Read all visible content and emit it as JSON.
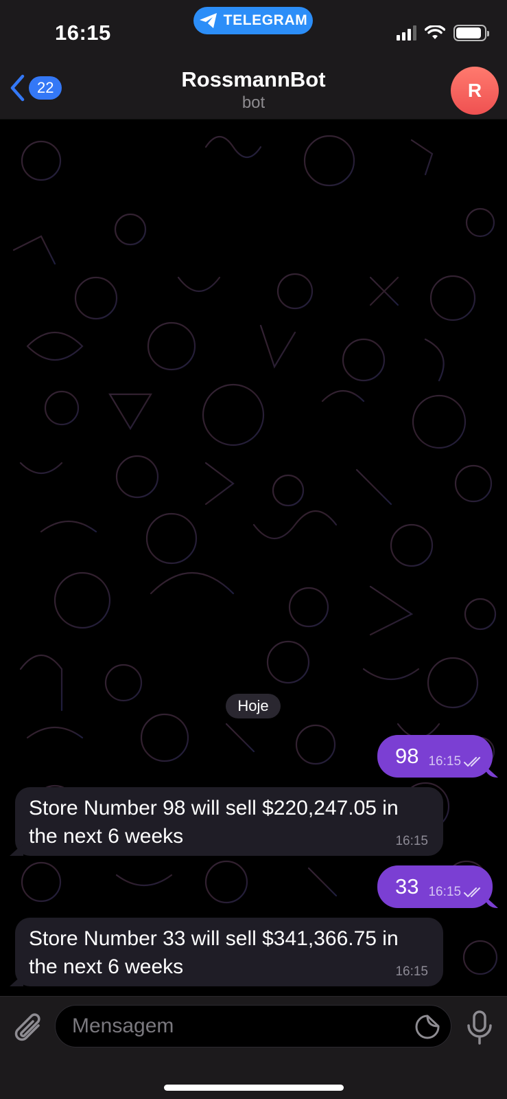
{
  "status_bar": {
    "time": "16:15",
    "app_pill": "TELEGRAM",
    "signal_bars": 3,
    "battery_level": 0.9
  },
  "header": {
    "back_count": "22",
    "title": "RossmannBot",
    "subtitle": "bot",
    "avatar_initial": "R",
    "avatar_color": "#ef5151"
  },
  "chat": {
    "date_chip": "Hoje",
    "messages": [
      {
        "direction": "out",
        "text": "98",
        "time": "16:15",
        "status": "read"
      },
      {
        "direction": "in",
        "text": "Store Number 98 will sell $220,247.05 in the next 6 weeks",
        "time": "16:15"
      },
      {
        "direction": "out",
        "text": "33",
        "time": "16:15",
        "status": "read"
      },
      {
        "direction": "in",
        "text": "Store Number 33 will sell $341,366.75 in the next 6 weeks",
        "time": "16:15"
      }
    ]
  },
  "composer": {
    "placeholder": "Mensagem",
    "value": ""
  },
  "colors": {
    "accent": "#3478f6",
    "outgoing_bubble": "#7b3fd3",
    "incoming_bubble": "#1f1d26",
    "telegram_pill": "#2c8ef8"
  },
  "icons": {
    "attach": "paperclip-icon",
    "sticker": "sticker-icon",
    "mic": "microphone-icon",
    "read": "double-check-icon",
    "back": "chevron-left-icon"
  }
}
